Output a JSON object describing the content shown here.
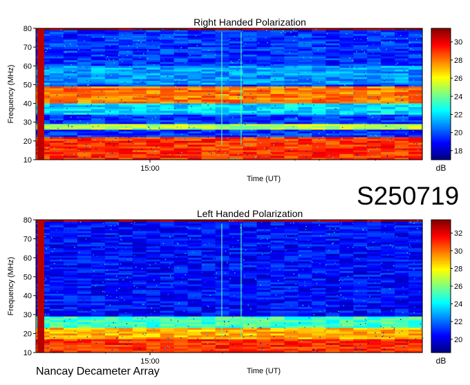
{
  "figure": {
    "session_id": "S250719",
    "observatory": "Nancay Decameter Array"
  },
  "chart_data": [
    {
      "type": "heatmap",
      "title": "Right Handed Polarization",
      "xlabel": "Time (UT)",
      "ylabel": "Frequency (MHz)",
      "x_ticks": [
        "15:00"
      ],
      "y_ticks": [
        10,
        20,
        30,
        40,
        50,
        60,
        70,
        80
      ],
      "ylim": [
        10,
        80
      ],
      "colorbar": {
        "label": "dB",
        "ticks": [
          18,
          20,
          22,
          24,
          26,
          28,
          30
        ],
        "range": [
          17,
          31.5
        ]
      },
      "colormap": "jet",
      "features": {
        "background_db": 19.5,
        "bands": [
          {
            "f_low": 10,
            "f_high": 22,
            "level_db": 29
          },
          {
            "f_low": 26,
            "f_high": 29,
            "level_db": 25
          },
          {
            "f_low": 40,
            "f_high": 49,
            "level_db": 28
          },
          {
            "f_low": 34,
            "f_high": 40,
            "level_db": 22
          },
          {
            "f_low": 50,
            "f_high": 60,
            "level_db": 21
          },
          {
            "f_low": 79,
            "f_high": 80,
            "level_db": 31
          }
        ]
      }
    },
    {
      "type": "heatmap",
      "title": "Left Handed Polarization",
      "xlabel": "Time (UT)",
      "ylabel": "Frequency (MHz)",
      "x_ticks": [
        "15:00"
      ],
      "y_ticks": [
        10,
        20,
        30,
        40,
        50,
        60,
        70,
        80
      ],
      "ylim": [
        10,
        80
      ],
      "colorbar": {
        "label": "dB",
        "ticks": [
          20,
          22,
          24,
          26,
          28,
          30,
          32
        ],
        "range": [
          18.5,
          33.5
        ]
      },
      "colormap": "jet",
      "features": {
        "background_db": 20.5,
        "bands": [
          {
            "f_low": 10,
            "f_high": 17,
            "level_db": 31
          },
          {
            "f_low": 17,
            "f_high": 23,
            "level_db": 29
          },
          {
            "f_low": 23,
            "f_high": 29,
            "level_db": 25
          },
          {
            "f_low": 79,
            "f_high": 80,
            "level_db": 33
          }
        ]
      }
    }
  ]
}
